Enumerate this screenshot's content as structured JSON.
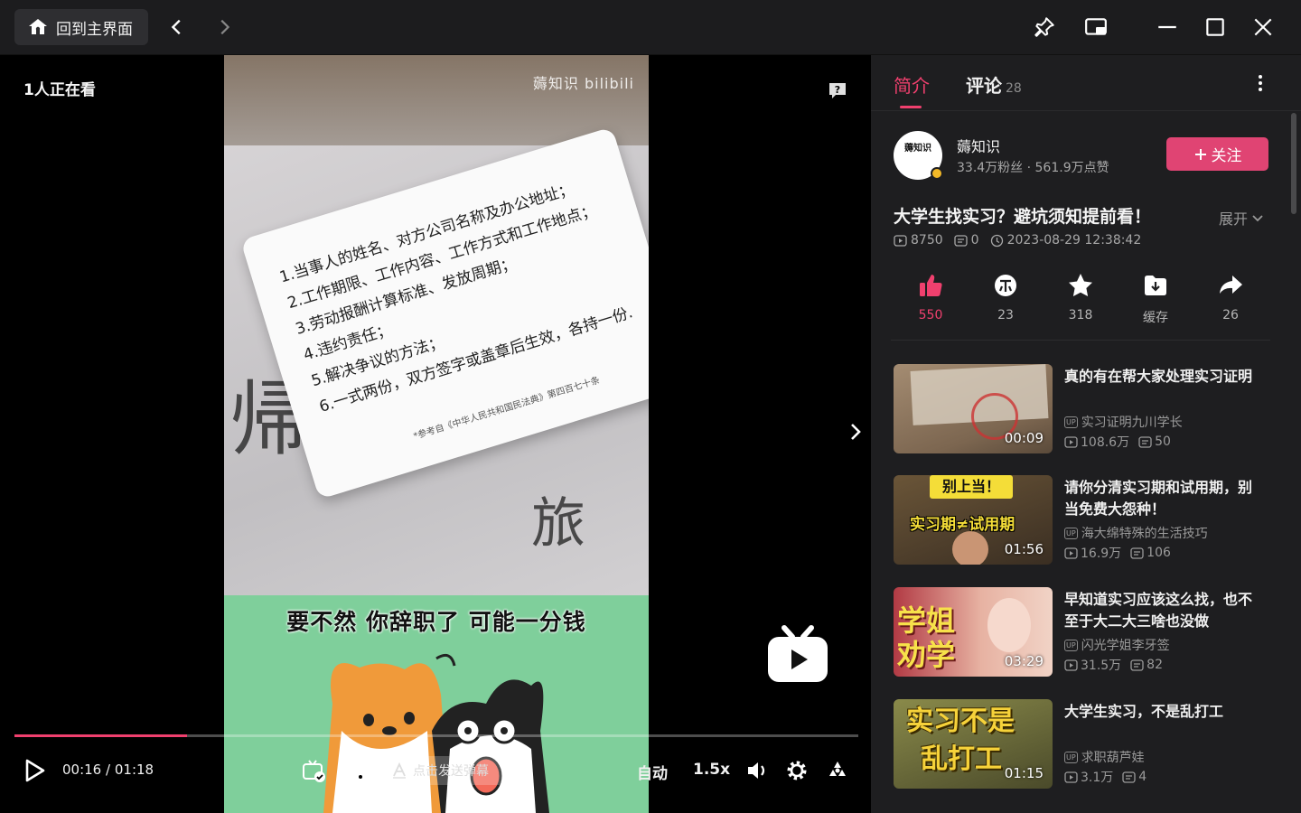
{
  "titlebar": {
    "home_label": "回到主界面"
  },
  "player": {
    "viewers": "1人正在看",
    "watermark": "薅知识 bilibili",
    "card_lines": [
      "1.当事人的姓名、对方公司名称及办公地址；",
      "2.工作期限、工作内容、工作方式和工作地点；",
      "3.劳动报酬计算标准、发放周期；",
      "4.违约责任；",
      "5.解决争议的方法；",
      "6.一式两份，双方签字或盖章后生效，各持一份."
    ],
    "card_ref": "*参考自《中华人民共和国民法典》第四百七十条",
    "subtitle": "要不然 你辞职了 可能一分钱",
    "progress_fraction": 0.205,
    "time_current": "00:16",
    "time_sep": "/",
    "time_total": "01:18",
    "danmaku_placeholder": "点击发送弹幕",
    "quality_label": "自动",
    "speed_label": "1.5x"
  },
  "side": {
    "tab_intro": "简介",
    "tab_comments": "评论",
    "comments_count": "28",
    "uploader": {
      "avatar_text": "薅知识",
      "name": "薅知识",
      "stats": "33.4万粉丝 · 561.9万点赞",
      "follow_label": "关注"
    },
    "video": {
      "title": "大学生找实习？避坑须知提前看！",
      "expand_label": "展开",
      "views": "8750",
      "danmaku": "0",
      "date": "2023-08-29 12:38:42"
    },
    "actions": [
      {
        "icon": "thumbs-up-icon",
        "count": "550"
      },
      {
        "icon": "coin-icon",
        "count": "23"
      },
      {
        "icon": "star-icon",
        "count": "318"
      },
      {
        "icon": "download-icon",
        "count": "缓存"
      },
      {
        "icon": "share-icon",
        "count": "26"
      }
    ],
    "recommendations": [
      {
        "title": "真的有在帮大家处理实习证明",
        "up": "实习证明九川学长",
        "views": "108.6万",
        "danmaku": "50",
        "duration": "00:09",
        "thumb_text": ""
      },
      {
        "title": "请你分清实习期和试用期，别当免费大怨种！",
        "up": "海大绵特殊的生活技巧",
        "views": "16.9万",
        "danmaku": "106",
        "duration": "01:56",
        "thumb_text": "别上当！",
        "thumb_text2": "实习期≠试用期"
      },
      {
        "title": "早知道实习应该这么找，也不至于大二大三啥也没做",
        "up": "闪光学姐李牙签",
        "views": "31.5万",
        "danmaku": "82",
        "duration": "03:29",
        "thumb_text": "学姐",
        "thumb_text2": "劝学"
      },
      {
        "title": "大学生实习，不是乱打工",
        "up": "求职葫芦娃",
        "views": "3.1万",
        "danmaku": "4",
        "duration": "01:15",
        "thumb_text": "实习不是",
        "thumb_text2": "乱打工"
      }
    ],
    "up_badge": "UP"
  },
  "colors": {
    "accent": "#f0406e",
    "panel": "#1e1e20",
    "titlebar": "#1c1c1e"
  }
}
